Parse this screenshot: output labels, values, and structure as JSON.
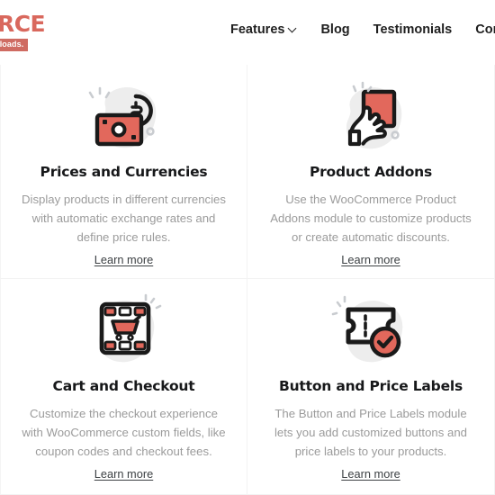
{
  "header": {
    "brand": {
      "wordmark": "MERCE",
      "tagline": "on Downloads."
    },
    "nav": [
      {
        "label": "Features",
        "icon": "chevron-down-icon",
        "has_chevron": true
      },
      {
        "label": "Blog",
        "has_chevron": false
      },
      {
        "label": "Testimonials",
        "has_chevron": false
      },
      {
        "label": "Contact us",
        "has_chevron": false
      }
    ]
  },
  "colors": {
    "brand_red": "#d9685d",
    "icon_red": "#e2685c",
    "icon_outline": "#1a1a1a",
    "icon_blob": "#ededed",
    "title": "#17181a",
    "body_text": "#9b9b9b",
    "divider": "#f2f2f2"
  },
  "features": [
    {
      "icon": "banknote-exchange-icon",
      "title": "Prices and Currencies",
      "description": "Display products in different currencies with automatic exchange rates and define price rules.",
      "link_label": "Learn more"
    },
    {
      "icon": "hand-holding-card-icon",
      "title": "Product Addons",
      "description": "Use the WooCommerce Product Addons module to customize products or create automatic discounts.",
      "link_label": "Learn more"
    },
    {
      "icon": "shopping-cart-screen-icon",
      "title": "Cart and Checkout",
      "description": "Customize the checkout experience with WooCommerce custom fields, like coupon codes and checkout fees.",
      "link_label": "Learn more"
    },
    {
      "icon": "price-tag-check-icon",
      "title": "Button and Price Labels",
      "description": "The Button and Price Labels module lets you add customized buttons and price labels to your products.",
      "link_label": "Learn more"
    }
  ]
}
